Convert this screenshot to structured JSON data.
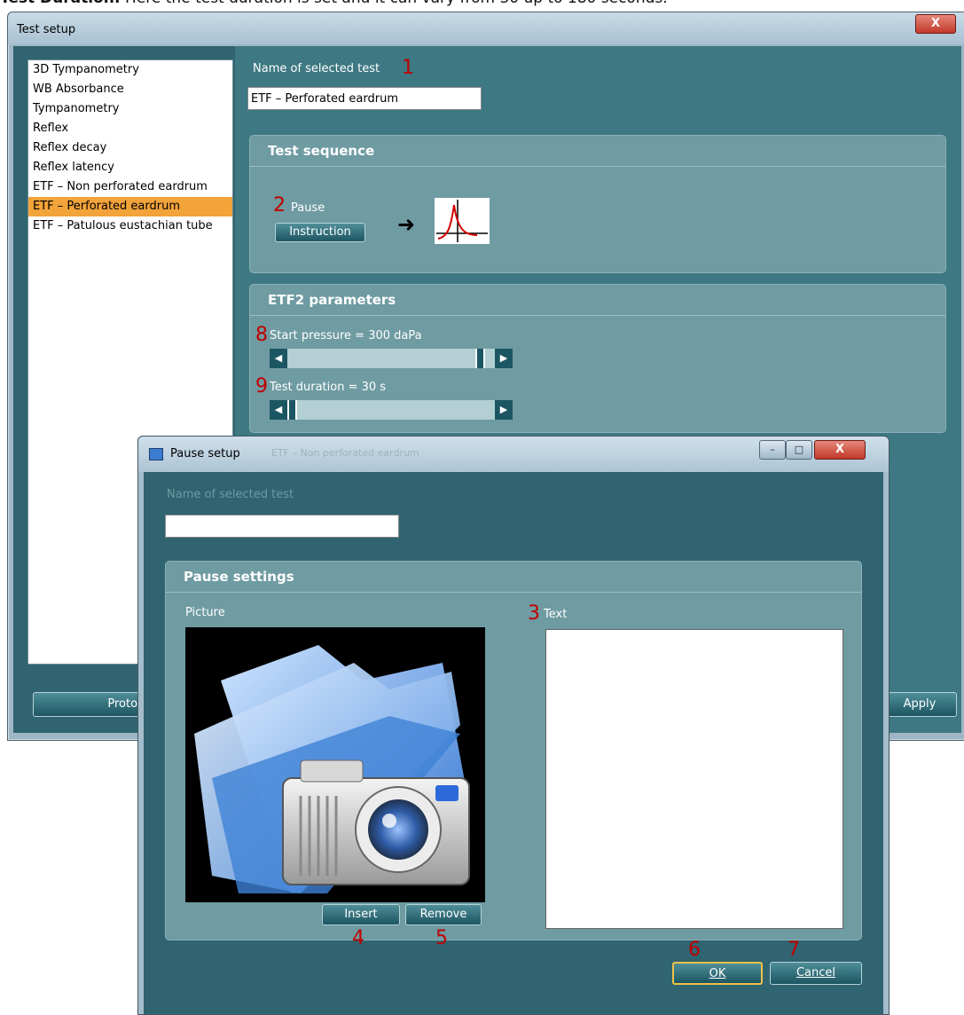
{
  "caption": {
    "bold": "Test Duration:",
    "text": " Here the test duration is set and it can vary from 30 up to 180 seconds."
  },
  "main_window": {
    "title": "Test setup",
    "close_label": "X",
    "tests": [
      "3D Tympanometry",
      "WB Absorbance",
      "Tympanometry",
      "Reflex",
      "Reflex decay",
      "Reflex latency",
      "ETF – Non perforated eardrum",
      "ETF – Perforated eardrum",
      "ETF – Patulous eustachian tube"
    ],
    "selected_index": 7,
    "name_label": "Name of selected test",
    "name_value": "ETF – Perforated eardrum",
    "test_sequence": {
      "header": "Test sequence",
      "pause_label": "Pause",
      "instruction_button": "Instruction",
      "arrow": "➜"
    },
    "etf2": {
      "header": "ETF2 parameters",
      "start_pressure_label": "Start pressure = 300 daPa",
      "start_pressure_level": 0.95,
      "test_duration_label": "Test duration = 30 s",
      "test_duration_level": 0.0
    },
    "protocol_button": "Protocol se",
    "apply_button": "Apply"
  },
  "pause_dialog": {
    "title": "Pause setup",
    "behind_title": "ETF – Non perforated eardrum",
    "minimize": "–",
    "maximize": "□",
    "close": "X",
    "name_label": "Name of selected test",
    "name_value": "",
    "settings_header": "Pause settings",
    "picture_label": "Picture",
    "text_label": "Text",
    "text_value": "",
    "insert_button": "Insert",
    "remove_button": "Remove",
    "ok_button": "OK",
    "cancel_button": "Cancel"
  },
  "markers": {
    "m1": "1",
    "m2": "2",
    "m3": "3",
    "m4": "4",
    "m5": "5",
    "m6": "6",
    "m7": "7",
    "m8": "8",
    "m9": "9"
  }
}
